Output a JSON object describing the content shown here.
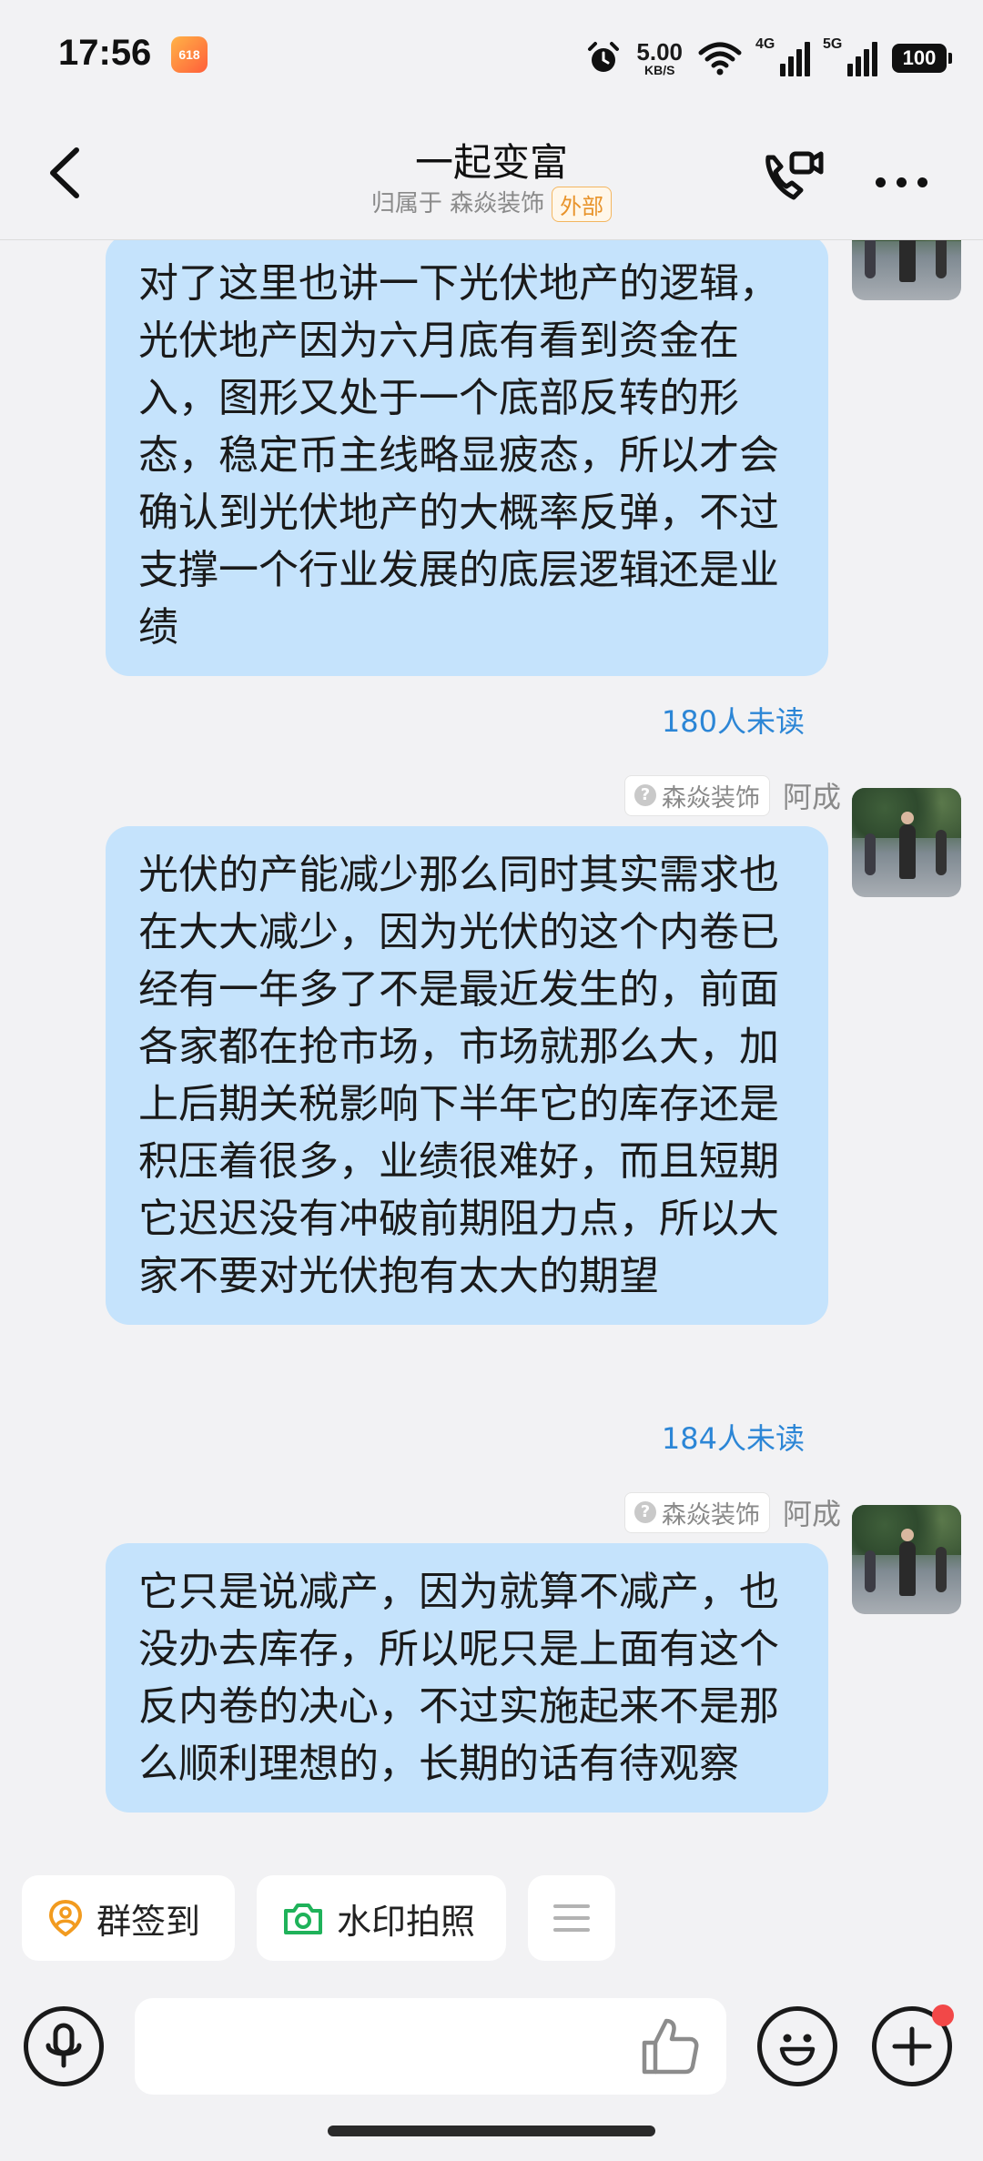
{
  "status_bar": {
    "time": "17:56",
    "app_badge": "618",
    "net_speed_value": "5.00",
    "net_speed_unit": "KB/S",
    "signal_4g": "4G",
    "signal_5g": "5G",
    "battery": "100"
  },
  "header": {
    "title": "一起变富",
    "subtitle": "归属于 森焱装饰",
    "tag": "外部"
  },
  "messages": [
    {
      "text": "对了这里也讲一下光伏地产的逻辑，光伏地产因为六月底有看到资金在入，图形又处于一个底部反转的形态，稳定币主线略显疲态，所以才会确认到光伏地产的大概率反弹，不过支撑一个行业发展的底层逻辑还是业绩",
      "read_status": "180人未读"
    },
    {
      "org": "森焱装饰",
      "sender": "阿成",
      "text": "光伏的产能减少那么同时其实需求也在大大减少，因为光伏的这个内卷已经有一年多了不是最近发生的，前面各家都在抢市场，市场就那么大，加上后期关税影响下半年它的库存还是积压着很多，业绩很难好，而且短期它迟迟没有冲破前期阻力点，所以大家不要对光伏抱有太大的期望",
      "read_status": "184人未读"
    },
    {
      "org": "森焱装饰",
      "sender": "阿成",
      "text": "它只是说减产，因为就算不减产，也没办去库存，所以呢只是上面有这个反内卷的决心，不过实施起来不是那么顺利理想的，长期的话有待观察"
    }
  ],
  "quick_actions": {
    "checkin": "群签到",
    "watermark_photo": "水印拍照"
  },
  "input": {
    "placeholder": ""
  },
  "colors": {
    "bubble": "#c5e3fc",
    "read_status": "#2c86d6",
    "external_tag": "#e8932a",
    "checkin_icon": "#f29b1f",
    "camera_icon": "#1fb25a",
    "notification_dot": "#f24848"
  }
}
